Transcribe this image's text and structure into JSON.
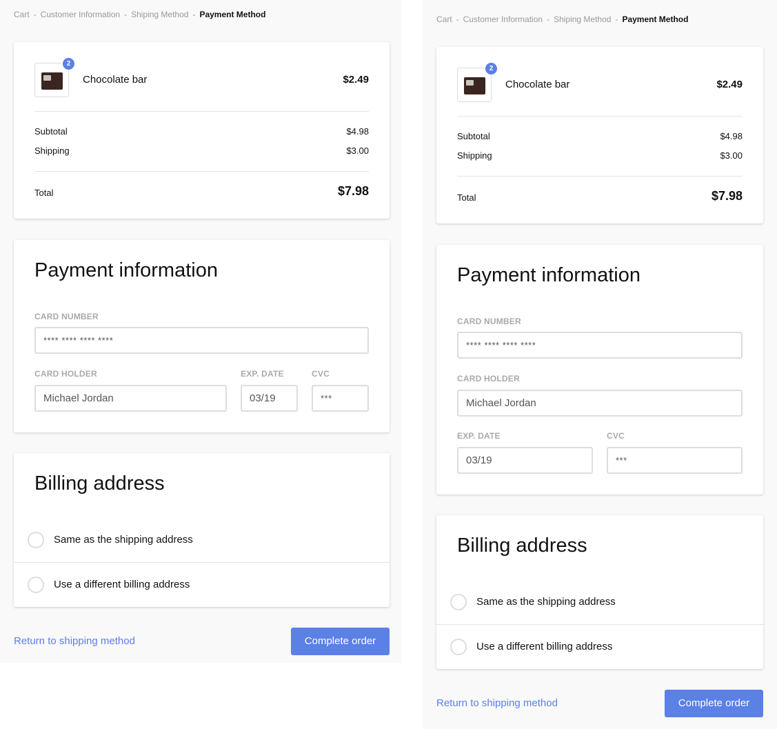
{
  "breadcrumb": {
    "items": [
      "Cart",
      "Customer Information",
      "Shiping Method",
      "Payment Method"
    ],
    "separator": "-"
  },
  "order": {
    "product_name": "Chocolate bar",
    "product_price": "$2.49",
    "quantity": "2",
    "subtotal_label": "Subtotal",
    "subtotal_value": "$4.98",
    "shipping_label": "Shipping",
    "shipping_value": "$3.00",
    "total_label": "Total",
    "total_value": "$7.98"
  },
  "payment": {
    "title": "Payment information",
    "card_number_label": "CARD NUMBER",
    "card_number_value": "**** **** **** ****",
    "card_holder_label": "CARD HOLDER",
    "card_holder_value": "Michael Jordan",
    "exp_label": "EXP. DATE",
    "exp_value": "03/19",
    "cvc_label": "CVC",
    "cvc_value": "***"
  },
  "billing": {
    "title": "Billing address",
    "options": [
      "Same as the shipping address",
      "Use a different billing address"
    ]
  },
  "actions": {
    "return_label": "Return to shipping method",
    "complete_label": "Complete order"
  },
  "colors": {
    "accent": "#5b80e6",
    "background": "#f9f9f9",
    "card": "#ffffff"
  }
}
